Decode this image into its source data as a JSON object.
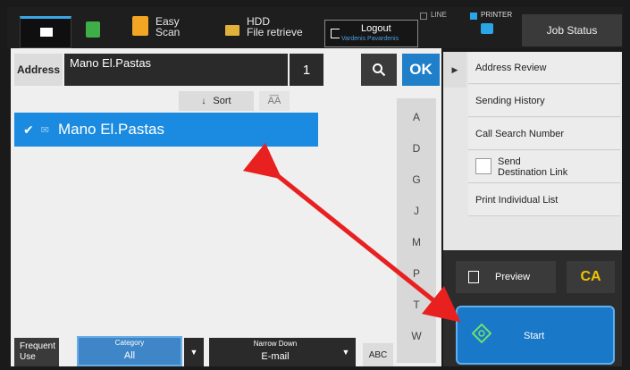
{
  "topbar": {
    "easy_scan": "Easy Scan",
    "easy_scan_l1": "Easy",
    "easy_scan_l2": "Scan",
    "hdd_l1": "HDD",
    "hdd_l2": "File retrieve",
    "logout": "Logout",
    "user_name": "Vardenis Pavardenis",
    "line": "LINE",
    "printer": "PRINTER",
    "job_status": "Job Status",
    "colors": {
      "active_indicator": "#3aa6e6",
      "printer_dot": "#2aa6e6",
      "easy_scan_icon": "#f2a623",
      "copy_icon": "#3fae49"
    }
  },
  "address_bar": {
    "label": "Address",
    "value": "Mano El.Pastas",
    "count": "1",
    "ok": "OK"
  },
  "sort": {
    "label": "Sort"
  },
  "list": {
    "selected_entry": "Mano El.Pastas"
  },
  "index_letters": [
    "A",
    "D",
    "G",
    "J",
    "M",
    "P",
    "T",
    "W"
  ],
  "bottom": {
    "frequent_l1": "Frequent",
    "frequent_l2": "Use",
    "category_label": "Category",
    "category_value": "All",
    "narrow_label": "Narrow Down",
    "narrow_value": "E-mail",
    "abc": "ABC"
  },
  "right_panel": {
    "address_review": "Address Review",
    "sending_history": "Sending History",
    "call_search_number": "Call Search Number",
    "send_dest_l1": "Send",
    "send_dest_l2": "Destination Link",
    "print_individual": "Print Individual List"
  },
  "actions": {
    "preview": "Preview",
    "ca": "CA",
    "start": "Start"
  }
}
